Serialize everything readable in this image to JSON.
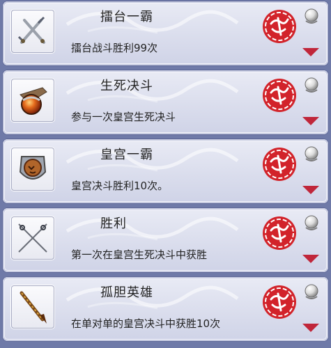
{
  "achievements": [
    {
      "title": "擂台一霸",
      "desc": "擂台战斗胜利99次",
      "icon": "crossed-swords-icon",
      "badge": "seal-completed-icon"
    },
    {
      "title": "生死决斗",
      "desc": "参与一次皇宫生死决斗",
      "icon": "war-horn-icon",
      "badge": "seal-completed-icon"
    },
    {
      "title": "皇宫一霸",
      "desc": "皇宫决斗胜利10次。",
      "icon": "lion-shield-icon",
      "badge": "seal-completed-icon"
    },
    {
      "title": "胜利",
      "desc": "第一次在皇宫生死决斗中获胜",
      "icon": "crossed-rapiers-icon",
      "badge": "seal-completed-icon"
    },
    {
      "title": "孤胆英雄",
      "desc": "在单对单的皇宫决斗中获胜10次",
      "icon": "golden-spear-icon",
      "badge": "seal-completed-icon"
    }
  ],
  "colors": {
    "seal_red": "#d2232a",
    "arrow_red": "#c0263a",
    "card_bg": "#e3e5f1",
    "page_bg": "#6f7aa8"
  }
}
